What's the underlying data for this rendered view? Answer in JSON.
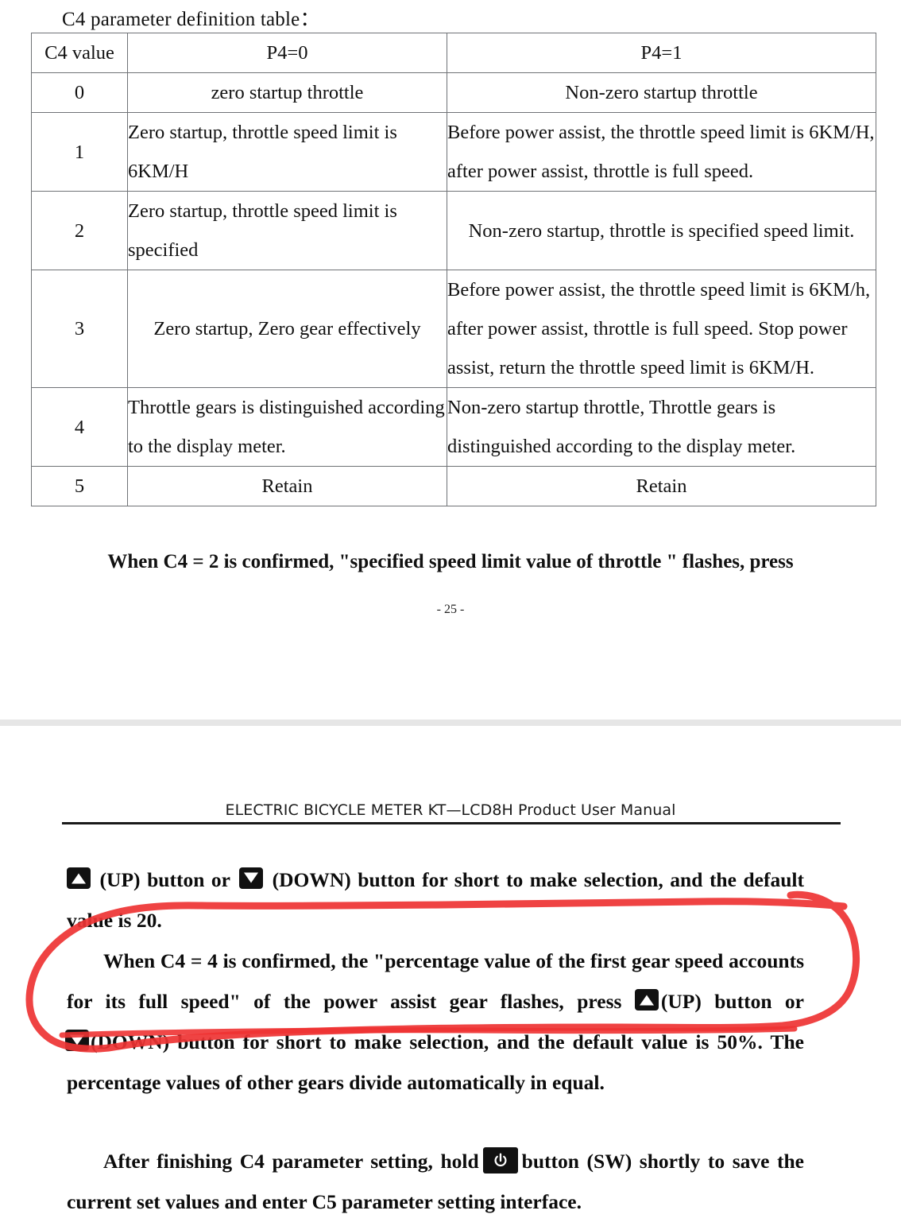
{
  "page_one": {
    "caption_above": "C4 parameter definition table：",
    "table": {
      "headers": [
        "C4 value",
        "P4=0",
        "P4=1"
      ],
      "rows": [
        {
          "value": "0",
          "p4_0": [
            "zero startup throttle"
          ],
          "p4_1": [
            "Non-zero startup throttle"
          ]
        },
        {
          "value": "1",
          "p4_0": [
            "Zero  startup,  throttle  speed  limit  is",
            "6KM/H"
          ],
          "p4_1": [
            "Before  power  assist,  the  throttle  speed  limit  is",
            "6KM/H, after power assist, throttle is full speed."
          ]
        },
        {
          "value": "2",
          "p4_0": [
            "Zero  startup,  throttle  speed  limit  is",
            "specified"
          ],
          "p4_1": [
            "Non-zero startup, throttle is specified speed limit."
          ]
        },
        {
          "value": "3",
          "p4_0": [
            "Zero startup, Zero gear effectively"
          ],
          "p4_1": [
            "Before  power  assist,  the  throttle  speed  limit  is",
            "6KM/h, after power assist, throttle is full speed.",
            "Stop power assist,  return the throttle speed limit is",
            "6KM/H."
          ]
        },
        {
          "value": "4",
          "p4_0": [
            "Throttle    gears    is    distinguished",
            "according to the display meter."
          ],
          "p4_1": [
            "Non-zero  startup  throttle,  Throttle  gears  is",
            "distinguished according to the display meter."
          ]
        },
        {
          "value": "5",
          "p4_0": [
            "Retain"
          ],
          "p4_1": [
            "Retain"
          ]
        }
      ]
    },
    "caption_below": "When C4 = 2 is confirmed, \"specified speed limit value of throttle \" flashes, press",
    "page_number": "- 25 -"
  },
  "page_two": {
    "header_title": "ELECTRIC BICYCLE METER KT—LCD8H Product User Manual",
    "paragraphs": {
      "p1_line1_a": " (UP) button or",
      "p1_line1_b": " (DOWN) button for short to make selection, and the default",
      "p1_line2": "value is 20.",
      "p2_line1": "When C4 = 4 is confirmed, the \"percentage value of the first gear speed accounts",
      "p2_line2_a": "for  its  full  speed\"  of  the  power  assist  gear  flashes,  press ",
      "p2_line2_b": "(UP)  button  or",
      "p2_line3_a": "(DOWN) button for short to make selection, and the default value is 50%. The",
      "p2_line4": "percentage values of other gears divide automatically in equal.",
      "p3_line1_a": "After finishing C4 parameter setting, hold",
      "p3_line1_b": "button (SW) shortly to save the",
      "p3_line2": "current set values and enter C5 parameter setting interface."
    },
    "icons": {
      "up": "up-triangle-button-icon",
      "down": "down-triangle-button-icon",
      "power": "power-button-icon"
    }
  },
  "annotation": {
    "type": "handwritten-red-ellipse",
    "color": "#ee3333",
    "stroke_width": 9
  }
}
